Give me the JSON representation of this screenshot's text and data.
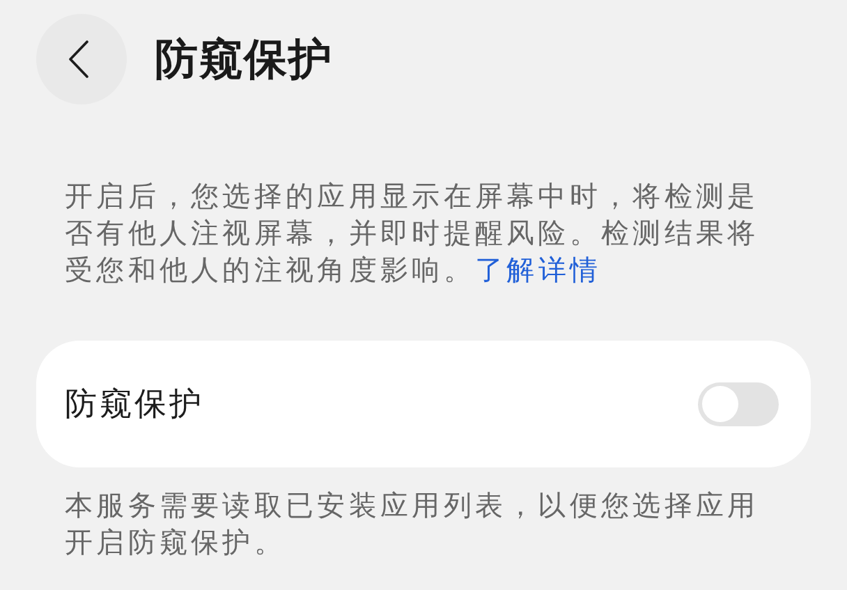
{
  "header": {
    "title": "防窥保护"
  },
  "description": {
    "text": "开启后，您选择的应用显示在屏幕中时，将检测是否有他人注视屏幕，并即时提醒风险。检测结果将受您和他人的注视角度影响。",
    "link": "了解详情"
  },
  "settings": [
    {
      "kind": "switch",
      "label": "防窥保护",
      "on": false
    }
  ],
  "footnote": "本服务需要读取已安装应用列表，以便您选择应用开启防窥保护。"
}
